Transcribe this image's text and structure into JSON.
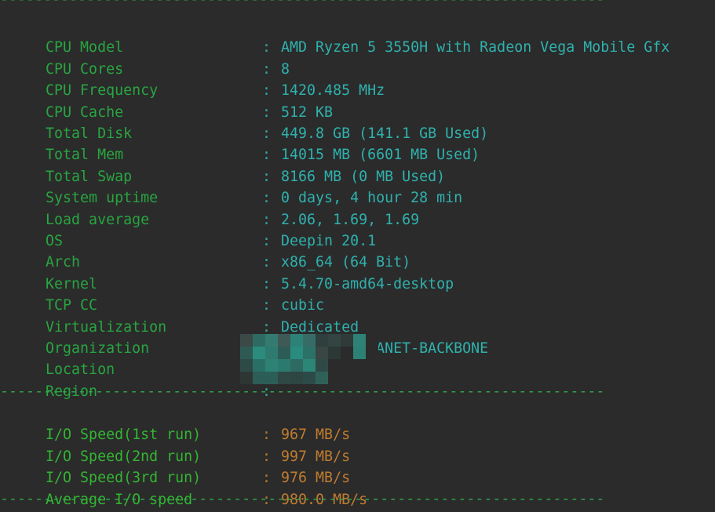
{
  "terminal": {
    "divider": "----------------------------------------------------------------------",
    "system_info": [
      {
        "key": "CPU Model",
        "value": "AMD Ryzen 5 3550H with Radeon Vega Mobile Gfx"
      },
      {
        "key": "CPU Cores",
        "value": "8"
      },
      {
        "key": "CPU Frequency",
        "value": "1420.485 MHz"
      },
      {
        "key": "CPU Cache",
        "value": "512 KB"
      },
      {
        "key": "Total Disk",
        "value": "449.8 GB (141.1 GB Used)"
      },
      {
        "key": "Total Mem",
        "value": "14015 MB (6601 MB Used)"
      },
      {
        "key": "Total Swap",
        "value": "8166 MB (0 MB Used)"
      },
      {
        "key": "System uptime",
        "value": "0 days, 4 hour 28 min"
      },
      {
        "key": "Load average",
        "value": "2.06, 1.69, 1.69"
      },
      {
        "key": "OS",
        "value": "Deepin 20.1"
      },
      {
        "key": "Arch",
        "value": "x86_64 (64 Bit)"
      },
      {
        "key": "Kernel",
        "value": "5.4.70-amd64-desktop"
      },
      {
        "key": "TCP CC",
        "value": "cubic"
      },
      {
        "key": "Virtualization",
        "value": "Dedicated"
      },
      {
        "key": "Organization",
        "value": "AS4134 CHINANET-BACKBONE"
      },
      {
        "key": "Location",
        "value": ""
      },
      {
        "key": "Region",
        "value": ""
      }
    ],
    "io_speed": [
      {
        "key": "I/O Speed(1st run)",
        "value": "967 MB/s"
      },
      {
        "key": "I/O Speed(2nd run)",
        "value": "997 MB/s"
      },
      {
        "key": "I/O Speed(3rd run)",
        "value": "976 MB/s"
      },
      {
        "key": "Average I/O speed",
        "value": "980.0 MB/s"
      }
    ],
    "separator": ":",
    "colors": {
      "background": "#2b2b2b",
      "key_green": "#28a541",
      "value_cyan": "#2fb1ad",
      "io_value_orange": "#c07c30"
    }
  }
}
